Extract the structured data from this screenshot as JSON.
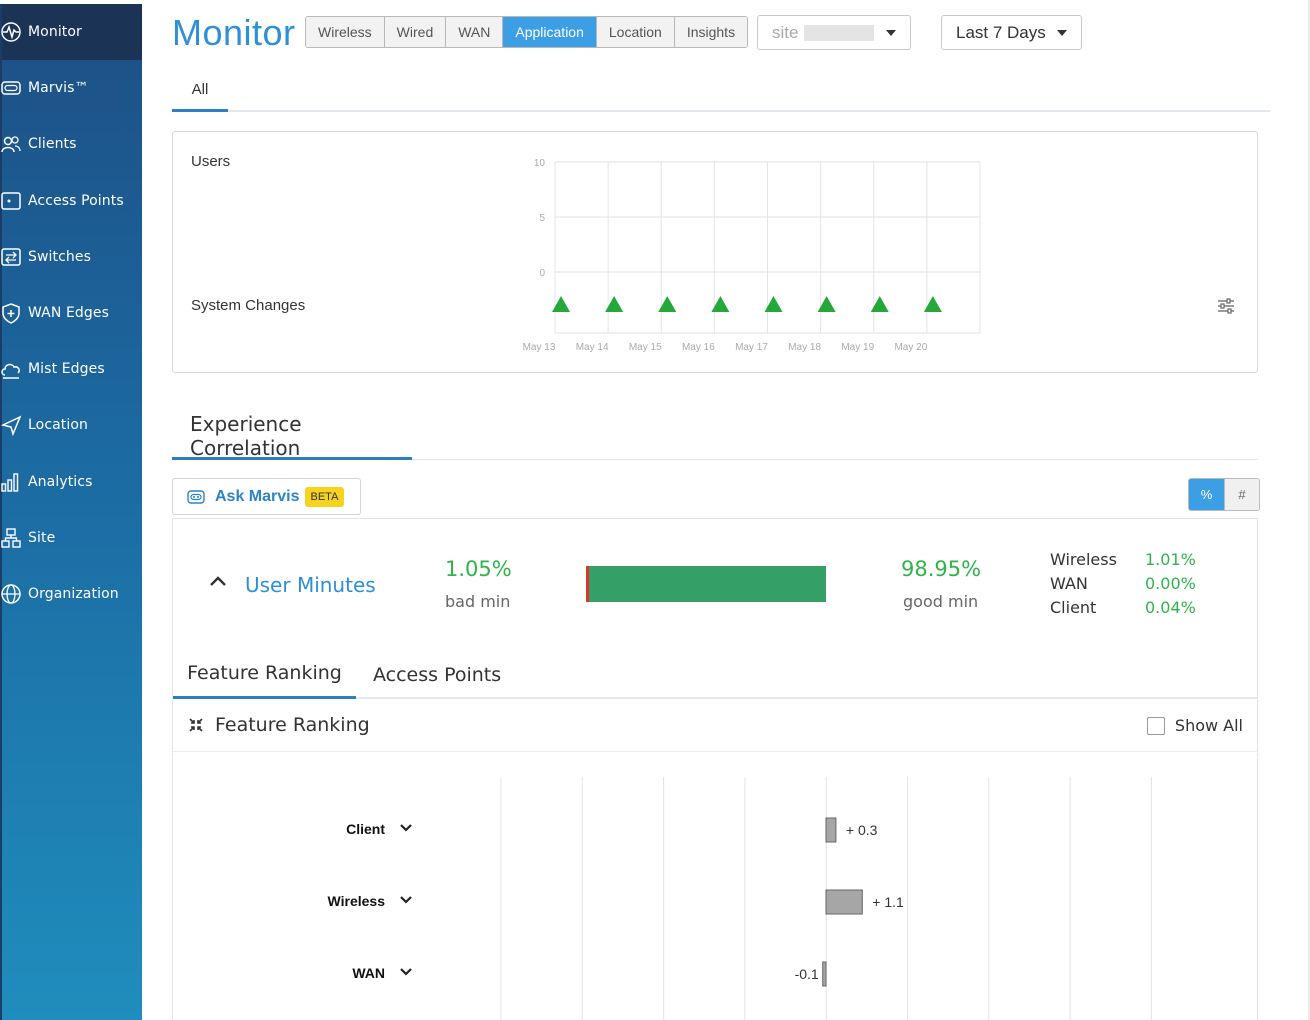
{
  "sidebar": {
    "items": [
      {
        "label": "Monitor",
        "icon": "monitor-pulse-icon",
        "active": true
      },
      {
        "label": "Marvis™",
        "icon": "marvis-icon"
      },
      {
        "label": "Clients",
        "icon": "clients-icon"
      },
      {
        "label": "Access Points",
        "icon": "access-point-icon"
      },
      {
        "label": "Switches",
        "icon": "switch-icon"
      },
      {
        "label": "WAN Edges",
        "icon": "wan-edge-icon"
      },
      {
        "label": "Mist Edges",
        "icon": "mist-edge-icon"
      },
      {
        "label": "Location",
        "icon": "location-icon"
      },
      {
        "label": "Analytics",
        "icon": "analytics-icon"
      },
      {
        "label": "Site",
        "icon": "site-icon"
      },
      {
        "label": "Organization",
        "icon": "organization-icon"
      }
    ]
  },
  "header": {
    "title": "Monitor",
    "segments": [
      {
        "label": "Wireless",
        "active": false
      },
      {
        "label": "Wired",
        "active": false
      },
      {
        "label": "WAN",
        "active": false
      },
      {
        "label": "Application",
        "active": true
      },
      {
        "label": "Location",
        "active": false
      },
      {
        "label": "Insights",
        "active": false
      }
    ],
    "site_dropdown": {
      "label": "site"
    },
    "range_dropdown": {
      "label": "Last 7 Days"
    }
  },
  "tabs": {
    "all": "All"
  },
  "timeline": {
    "users_label": "Users",
    "system_changes_label": "System Changes"
  },
  "chart_data": {
    "type": "line",
    "title": "",
    "ylabel": "Users",
    "ylim": [
      0,
      10
    ],
    "y_ticks": [
      "10",
      "5",
      "0"
    ],
    "categories": [
      "May 13",
      "May 14",
      "May 15",
      "May 16",
      "May 17",
      "May 18",
      "May 19",
      "May 20"
    ],
    "series": [],
    "system_change_markers": [
      "May 13",
      "May 14",
      "May 15",
      "May 16",
      "May 17",
      "May 18",
      "May 19",
      "May 20"
    ],
    "grid": true
  },
  "experience": {
    "section_title": "Experience Correlation",
    "ask_marvis": {
      "label": "Ask Marvis",
      "badge": "BETA"
    },
    "toggle": {
      "percent": "%",
      "count": "#",
      "active": "percent"
    },
    "user_minutes": {
      "label": "User Minutes",
      "bad_pct": "1.05%",
      "bad_label": "bad min",
      "bad_fraction": 0.0105,
      "good_pct": "98.95%",
      "good_label": "good min",
      "breakdown": [
        {
          "label": "Wireless",
          "value": "1.01%"
        },
        {
          "label": "WAN",
          "value": "0.00%"
        },
        {
          "label": "Client",
          "value": "0.04%"
        }
      ]
    },
    "sub_tabs": {
      "feature_ranking": "Feature Ranking",
      "access_points": "Access Points"
    },
    "feature_ranking": {
      "title": "Feature Ranking",
      "show_all": "Show All",
      "features": [
        {
          "name": "Client",
          "value": 0.3,
          "label": "+ 0.3"
        },
        {
          "name": "Wireless",
          "value": 1.1,
          "label": "+ 1.1"
        },
        {
          "name": "WAN",
          "value": -0.1,
          "label": "-0.1"
        }
      ]
    }
  },
  "colors": {
    "accent": "#2f8fd8",
    "good": "#359f68",
    "bad": "#e0322b",
    "marker": "#25a83a",
    "pct_text": "#2fb44c"
  }
}
